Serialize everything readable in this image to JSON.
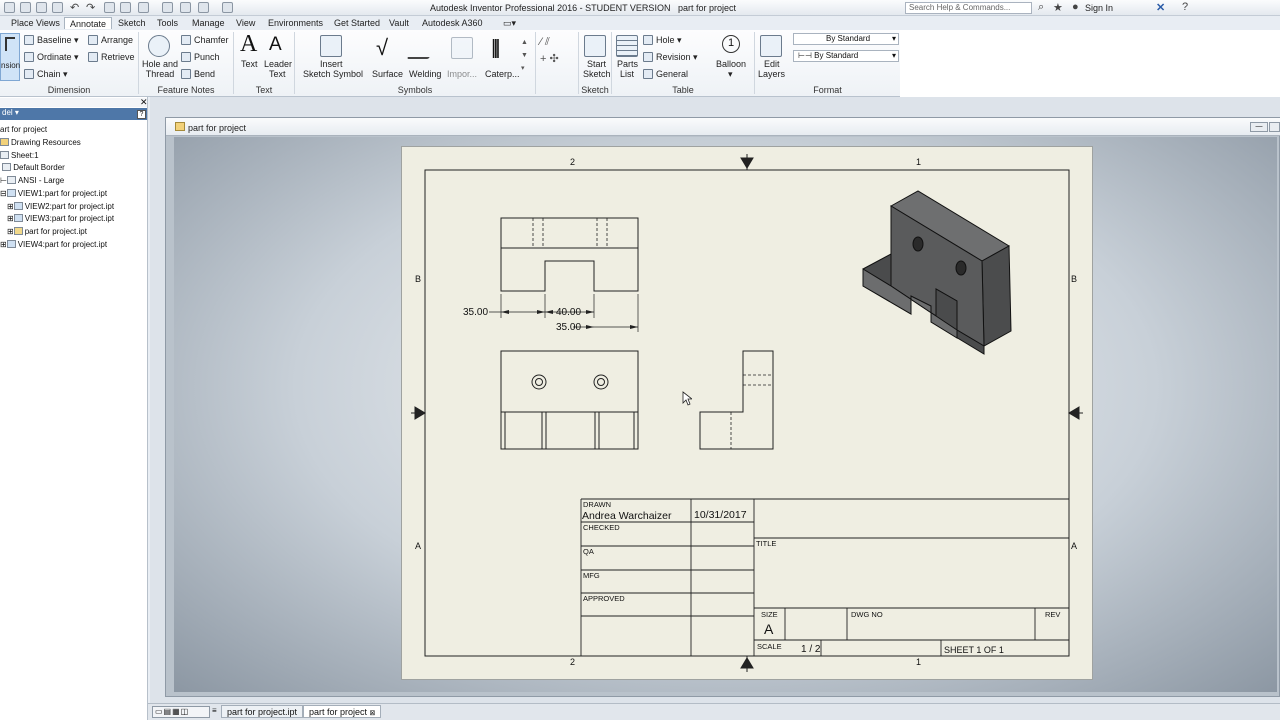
{
  "app": {
    "title": "Autodesk Inventor Professional 2016 - STUDENT VERSION",
    "document_name": "part for project",
    "search_placeholder": "Search Help & Commands...",
    "sign_in": "Sign In"
  },
  "ribbon_tabs": [
    "Place Views",
    "Annotate",
    "Sketch",
    "Tools",
    "Manage",
    "View",
    "Environments",
    "Get Started",
    "Vault",
    "Autodesk A360"
  ],
  "active_tab": "Annotate",
  "ribbon": {
    "dimension": {
      "partial": "nsion",
      "baseline": "Baseline",
      "ordinate": "Ordinate",
      "chain": "Chain",
      "arrange": "Arrange",
      "retrieve": "Retrieve",
      "title": "Dimension"
    },
    "feature_notes": {
      "hole_and_thread_1": "Hole and",
      "hole_and_thread_2": "Thread",
      "chamfer": "Chamfer",
      "punch": "Punch",
      "bend": "Bend",
      "title": "Feature Notes"
    },
    "text": {
      "text": "Text",
      "leader_1": "Leader",
      "leader_2": "Text",
      "title": "Text"
    },
    "symbols": {
      "insert_1": "Insert",
      "insert_2": "Sketch Symbol",
      "surface": "Surface",
      "welding": "Welding",
      "import": "Impor...",
      "caterpillar": "Caterp...",
      "title": "Symbols"
    },
    "sketch": {
      "start_1": "Start",
      "start_2": "Sketch",
      "title": "Sketch"
    },
    "table": {
      "parts_1": "Parts",
      "parts_2": "List",
      "hole": "Hole",
      "revision": "Revision",
      "general": "General",
      "title": "Table"
    },
    "balloon": {
      "label": "Balloon"
    },
    "format": {
      "edit_1": "Edit",
      "edit_2": "Layers",
      "style_1": "By Standard",
      "style_2": "By Standard",
      "title": "Format"
    }
  },
  "browser": {
    "header": "del",
    "items": [
      {
        "label": "art for project"
      },
      {
        "label": "Drawing Resources"
      },
      {
        "label": "Sheet:1"
      },
      {
        "label": "Default Border"
      },
      {
        "label": "ANSI - Large"
      },
      {
        "label": "VIEW1:part for project.ipt"
      },
      {
        "label": "VIEW2:part for project.ipt"
      },
      {
        "label": "VIEW3:part for project.ipt"
      },
      {
        "label": "part for project.ipt"
      },
      {
        "label": "VIEW4:part for project.ipt"
      }
    ]
  },
  "drawing": {
    "zone_cols": [
      "2",
      "1"
    ],
    "zone_rows": [
      "B",
      "A"
    ],
    "dim_left": "35.00",
    "dim_mid": "40.00",
    "dim_right": "35.00",
    "title_block": {
      "drawn_label": "DRAWN",
      "drawn_name": "Andrea Warchaizer",
      "drawn_date": "10/31/2017",
      "checked_label": "CHECKED",
      "qa_label": "QA",
      "mfg_label": "MFG",
      "approved_label": "APPROVED",
      "title_label": "TITLE",
      "size_label": "SIZE",
      "size_value": "A",
      "dwg_no_label": "DWG NO",
      "rev_label": "REV",
      "scale_label": "SCALE",
      "scale_value": "1 / 2",
      "sheet_label": "SHEET 1  OF 1"
    }
  },
  "bottom_tabs": [
    {
      "label": "part for project.ipt"
    },
    {
      "label": "part for project"
    }
  ]
}
